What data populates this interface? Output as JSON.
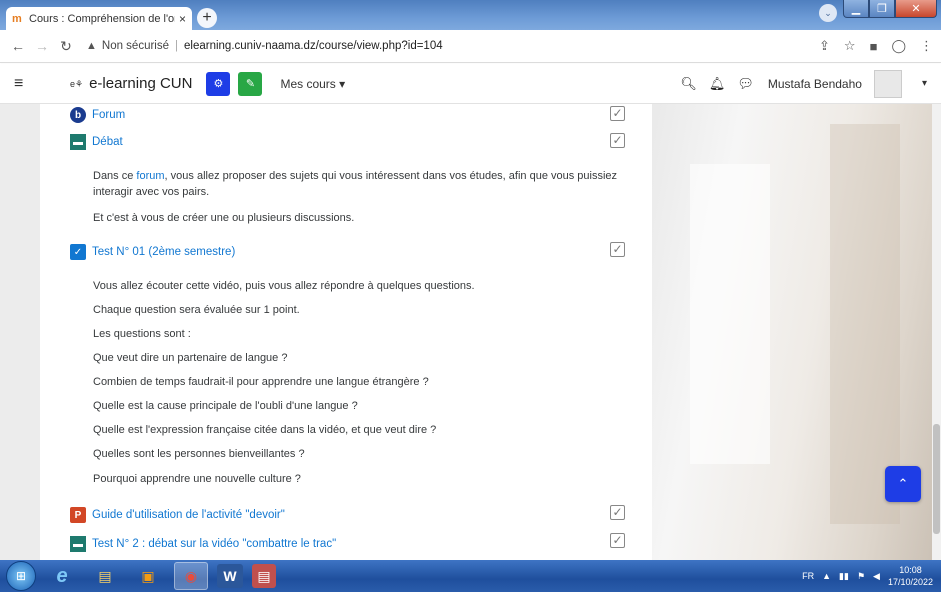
{
  "browser": {
    "tab_title": "Cours : Compréhension de l'oral",
    "tab_close": "×",
    "new_tab": "+",
    "security_label": "Non sécurisé",
    "url": "elearning.cuniv-naama.dz/course/view.php?id=104"
  },
  "navbar": {
    "brand": "e-learning CUN",
    "my_courses": "Mes cours",
    "username": "Mustafa Bendaho"
  },
  "activities": [
    {
      "label": "Forum",
      "icon_color": "#1a3b8f"
    },
    {
      "label": "Débat",
      "icon_color": "#1e7a6e"
    },
    {
      "label": "Test N° 01 (2ème semestre)",
      "icon_color": "#1177d1"
    },
    {
      "label": "Guide d'utilisation de l'activité \"devoir\"",
      "icon_color": "#d24726"
    },
    {
      "label": "Test N° 2 : débat sur la vidéo \"combattre le trac\"",
      "icon_color": "#1e7a6e"
    }
  ],
  "debat_desc": {
    "line1_before": "Dans ce ",
    "line1_link": "forum",
    "line1_after": ", vous allez proposer des sujets qui vous intéressent dans vos études, afin que vous puissiez interagir avec vos pairs.",
    "line2": "Et c'est à vous de créer une ou plusieurs discussions."
  },
  "test1_desc": [
    "Vous allez écouter cette vidéo, puis vous allez répondre à quelques questions.",
    "Chaque question sera évaluée sur 1 point.",
    "Les questions sont :",
    "Que veut dire un partenaire de langue ?",
    "Combien de temps faudrait-il pour apprendre une langue étrangère ?",
    "Quelle est la cause principale de l'oubli d'une langue ?",
    "Quelle est l'expression française citée dans la vidéo, et  que veut dire ?",
    "Quelles sont les personnes bienveillantes ?",
    "Pourquoi apprendre une nouvelle culture ?"
  ],
  "taskbar": {
    "lang": "FR",
    "time": "10:08",
    "date": "17/10/2022"
  }
}
